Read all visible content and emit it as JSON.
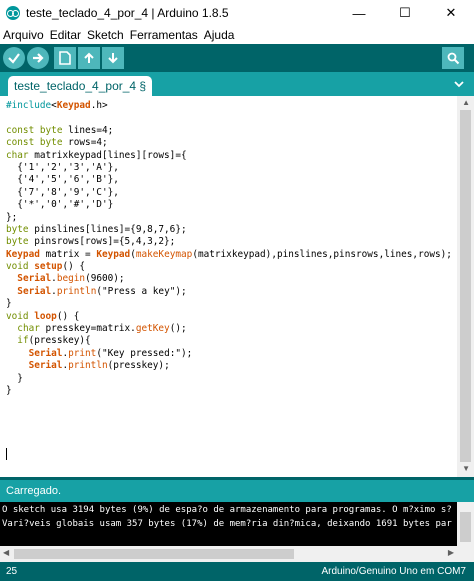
{
  "window": {
    "title": "teste_teclado_4_por_4 | Arduino 1.8.5",
    "minimize": "—",
    "maximize": "☐",
    "close": "✕"
  },
  "menu": [
    "Arquivo",
    "Editar",
    "Sketch",
    "Ferramentas",
    "Ajuda"
  ],
  "toolbar": {
    "icons": [
      "verify-icon",
      "upload-icon",
      "new-icon",
      "open-icon",
      "save-icon",
      "serial-monitor-icon"
    ]
  },
  "tab": {
    "label": "teste_teclado_4_por_4 §"
  },
  "code": [
    [
      [
        "kw2",
        "#include"
      ],
      [
        "",
        "<"
      ],
      [
        "kwb",
        "Keypad"
      ],
      [
        "",
        ".h>"
      ]
    ],
    [
      [
        "",
        ""
      ]
    ],
    [
      [
        "kw",
        "const"
      ],
      [
        "",
        " "
      ],
      [
        "kw",
        "byte"
      ],
      [
        "",
        " lines=4;"
      ]
    ],
    [
      [
        "kw",
        "const"
      ],
      [
        "",
        " "
      ],
      [
        "kw",
        "byte"
      ],
      [
        "",
        " rows=4;"
      ]
    ],
    [
      [
        "kw",
        "char"
      ],
      [
        "",
        " matrixkeypad[lines][rows]={"
      ]
    ],
    [
      [
        "",
        "  {'1','2','3','A'},"
      ]
    ],
    [
      [
        "",
        "  {'4','5','6','B'},"
      ]
    ],
    [
      [
        "",
        "  {'7','8','9','C'},"
      ]
    ],
    [
      [
        "",
        "  {'*','0','#','D'}"
      ]
    ],
    [
      [
        "",
        "};"
      ]
    ],
    [
      [
        "kw",
        "byte"
      ],
      [
        "",
        " pinslines[lines]={9,8,7,6};"
      ]
    ],
    [
      [
        "kw",
        "byte"
      ],
      [
        "",
        " pinsrows[rows]={5,4,3,2};"
      ]
    ],
    [
      [
        "kwb",
        "Keypad"
      ],
      [
        "",
        " matrix = "
      ],
      [
        "kwb",
        "Keypad"
      ],
      [
        "",
        "("
      ],
      [
        "fn",
        "makeKeymap"
      ],
      [
        "",
        "(matrixkeypad),pinslines,pinsrows,lines,rows);"
      ]
    ],
    [
      [
        "kw",
        "void"
      ],
      [
        "",
        " "
      ],
      [
        "kwb",
        "setup"
      ],
      [
        "",
        "() {"
      ]
    ],
    [
      [
        "",
        "  "
      ],
      [
        "kwb",
        "Serial"
      ],
      [
        "",
        "."
      ],
      [
        "fn",
        "begin"
      ],
      [
        "",
        "(9600);"
      ]
    ],
    [
      [
        "",
        "  "
      ],
      [
        "kwb",
        "Serial"
      ],
      [
        "",
        "."
      ],
      [
        "fn",
        "println"
      ],
      [
        "",
        "(\"Press a key\");"
      ]
    ],
    [
      [
        "",
        "}"
      ]
    ],
    [
      [
        "kw",
        "void"
      ],
      [
        "",
        " "
      ],
      [
        "kwb",
        "loop"
      ],
      [
        "",
        "() {"
      ]
    ],
    [
      [
        "",
        "  "
      ],
      [
        "kw",
        "char"
      ],
      [
        "",
        " presskey=matrix."
      ],
      [
        "fn",
        "getKey"
      ],
      [
        "",
        "();"
      ]
    ],
    [
      [
        "",
        "  "
      ],
      [
        "kw",
        "if"
      ],
      [
        "",
        "(presskey){"
      ]
    ],
    [
      [
        "",
        "    "
      ],
      [
        "kwb",
        "Serial"
      ],
      [
        "",
        "."
      ],
      [
        "fn",
        "print"
      ],
      [
        "",
        "(\"Key pressed:\");"
      ]
    ],
    [
      [
        "",
        "    "
      ],
      [
        "kwb",
        "Serial"
      ],
      [
        "",
        "."
      ],
      [
        "fn",
        "println"
      ],
      [
        "",
        "(presskey);"
      ]
    ],
    [
      [
        "",
        "  }"
      ]
    ],
    [
      [
        "",
        "}"
      ]
    ]
  ],
  "status": {
    "message": "Carregado."
  },
  "console": {
    "lines": [
      "O sketch usa 3194 bytes (9%) de espa?o de armazenamento para programas. O m?ximo s?",
      "Vari?veis globais usam 357 bytes (17%) de mem?ria din?mica, deixando 1691 bytes par"
    ]
  },
  "footer": {
    "line_number": "25",
    "board": "Arduino/Genuino Uno em COM7"
  },
  "colors": {
    "toolbar": "#006468",
    "tabbar": "#17a1a5",
    "button": "#4db7bb",
    "console_bg": "#000000"
  }
}
